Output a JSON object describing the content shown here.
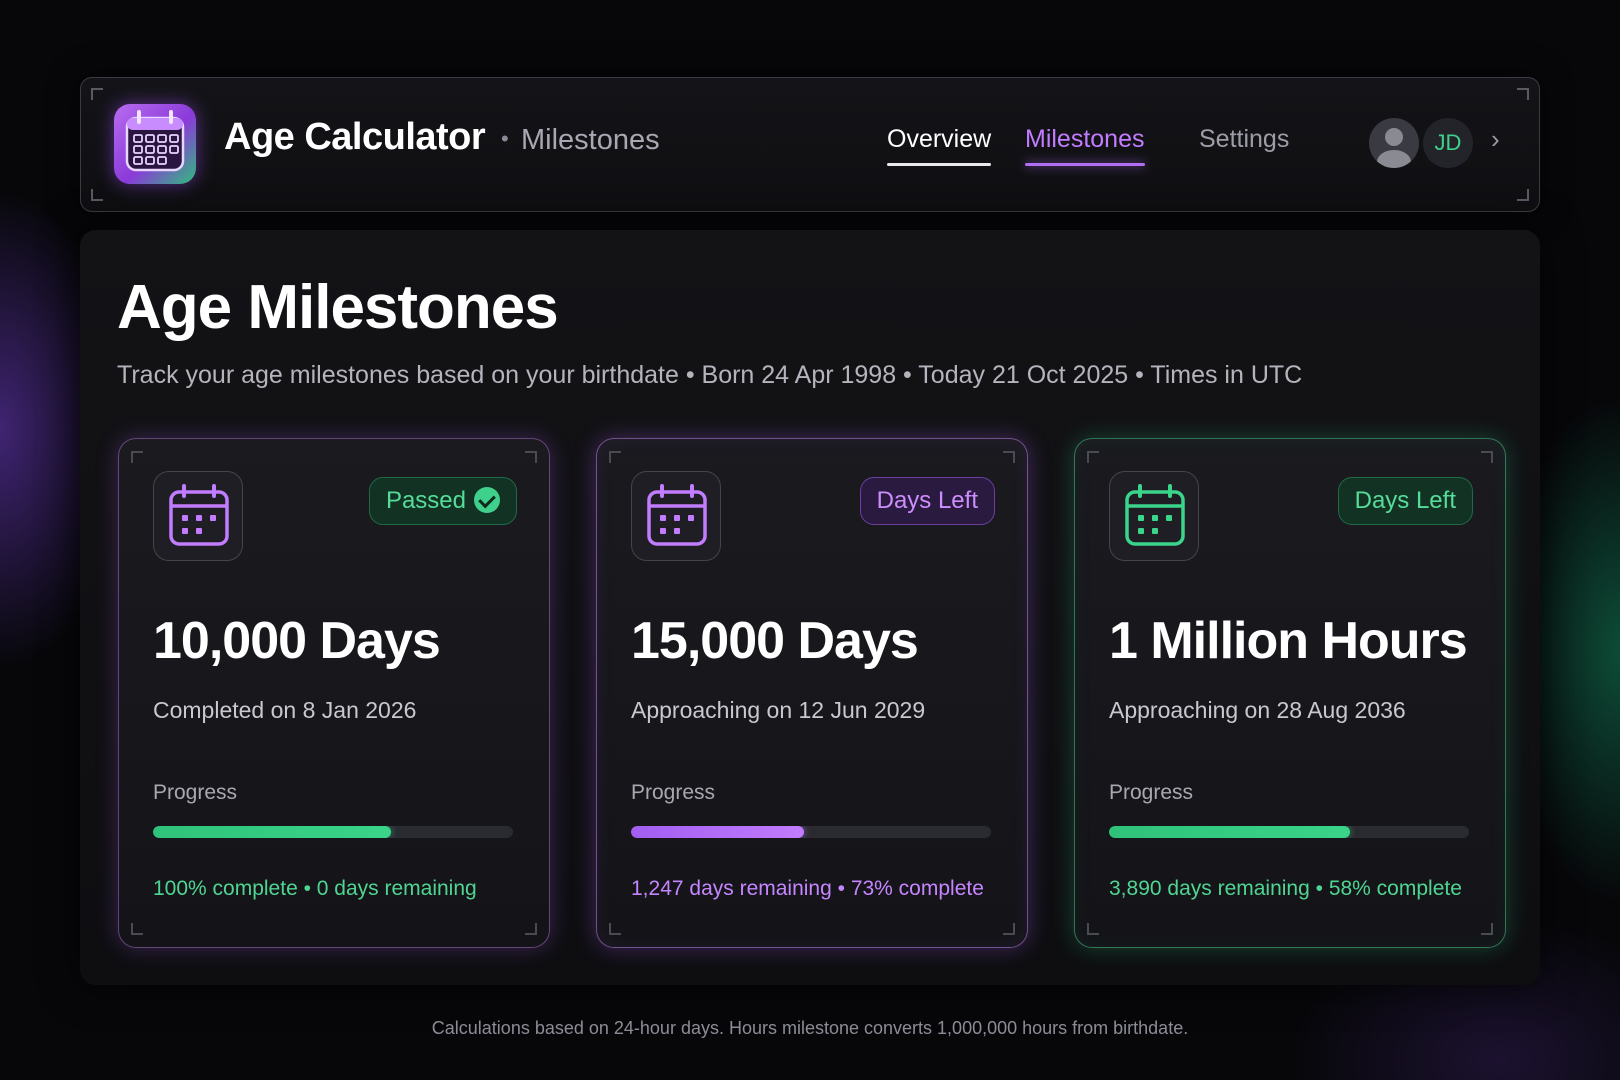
{
  "header": {
    "app_title": "Age Calculator",
    "separator": "•",
    "section": "Milestones",
    "tabs": [
      {
        "label": "Overview",
        "state": "default"
      },
      {
        "label": "Milestones",
        "state": "active"
      },
      {
        "label": "Settings",
        "state": "default"
      }
    ],
    "user_initials": "JD",
    "chevron": "›",
    "icons": {
      "logo": "calendar-icon",
      "avatar": "user-avatar-icon",
      "more": "chevron-right-icon"
    }
  },
  "page": {
    "title": "Age Milestones",
    "subtitle": "Track your age milestones based on your birthdate • Born 24 Apr 1998 • Today 21 Oct 2025 • Times in UTC"
  },
  "cards": [
    {
      "icon": "calendar-icon",
      "badge": "Passed",
      "badge_icon": "check-circle-icon",
      "value": "10,000 Days",
      "date_text": "Completed on 8 Jan 2026",
      "progress_label": "Progress",
      "progress": 0.66,
      "status_text": "100% complete • 0 days remaining",
      "accent": "#3bd48b"
    },
    {
      "icon": "calendar-icon",
      "badge": "Days Left",
      "value": "15,000 Days",
      "date_text": "Approaching on 12 Jun 2029",
      "progress_label": "Progress",
      "progress": 0.48,
      "status_text": "1,247 days remaining • 73% complete",
      "accent": "#c27cff"
    },
    {
      "icon": "calendar-icon",
      "badge": "Days Left",
      "value": "1 Million Hours",
      "date_text": "Approaching on 28 Aug 2036",
      "progress_label": "Progress",
      "progress": 0.67,
      "status_text": "3,890 days remaining • 58% complete",
      "accent": "#3bd48b"
    }
  ],
  "footnote": "Calculations based on 24-hour days. Hours milestone converts 1,000,000 hours from birthdate.",
  "colors": {
    "background": "#07070a",
    "accent_purple": "#c27cff",
    "accent_green": "#3bd48b"
  }
}
